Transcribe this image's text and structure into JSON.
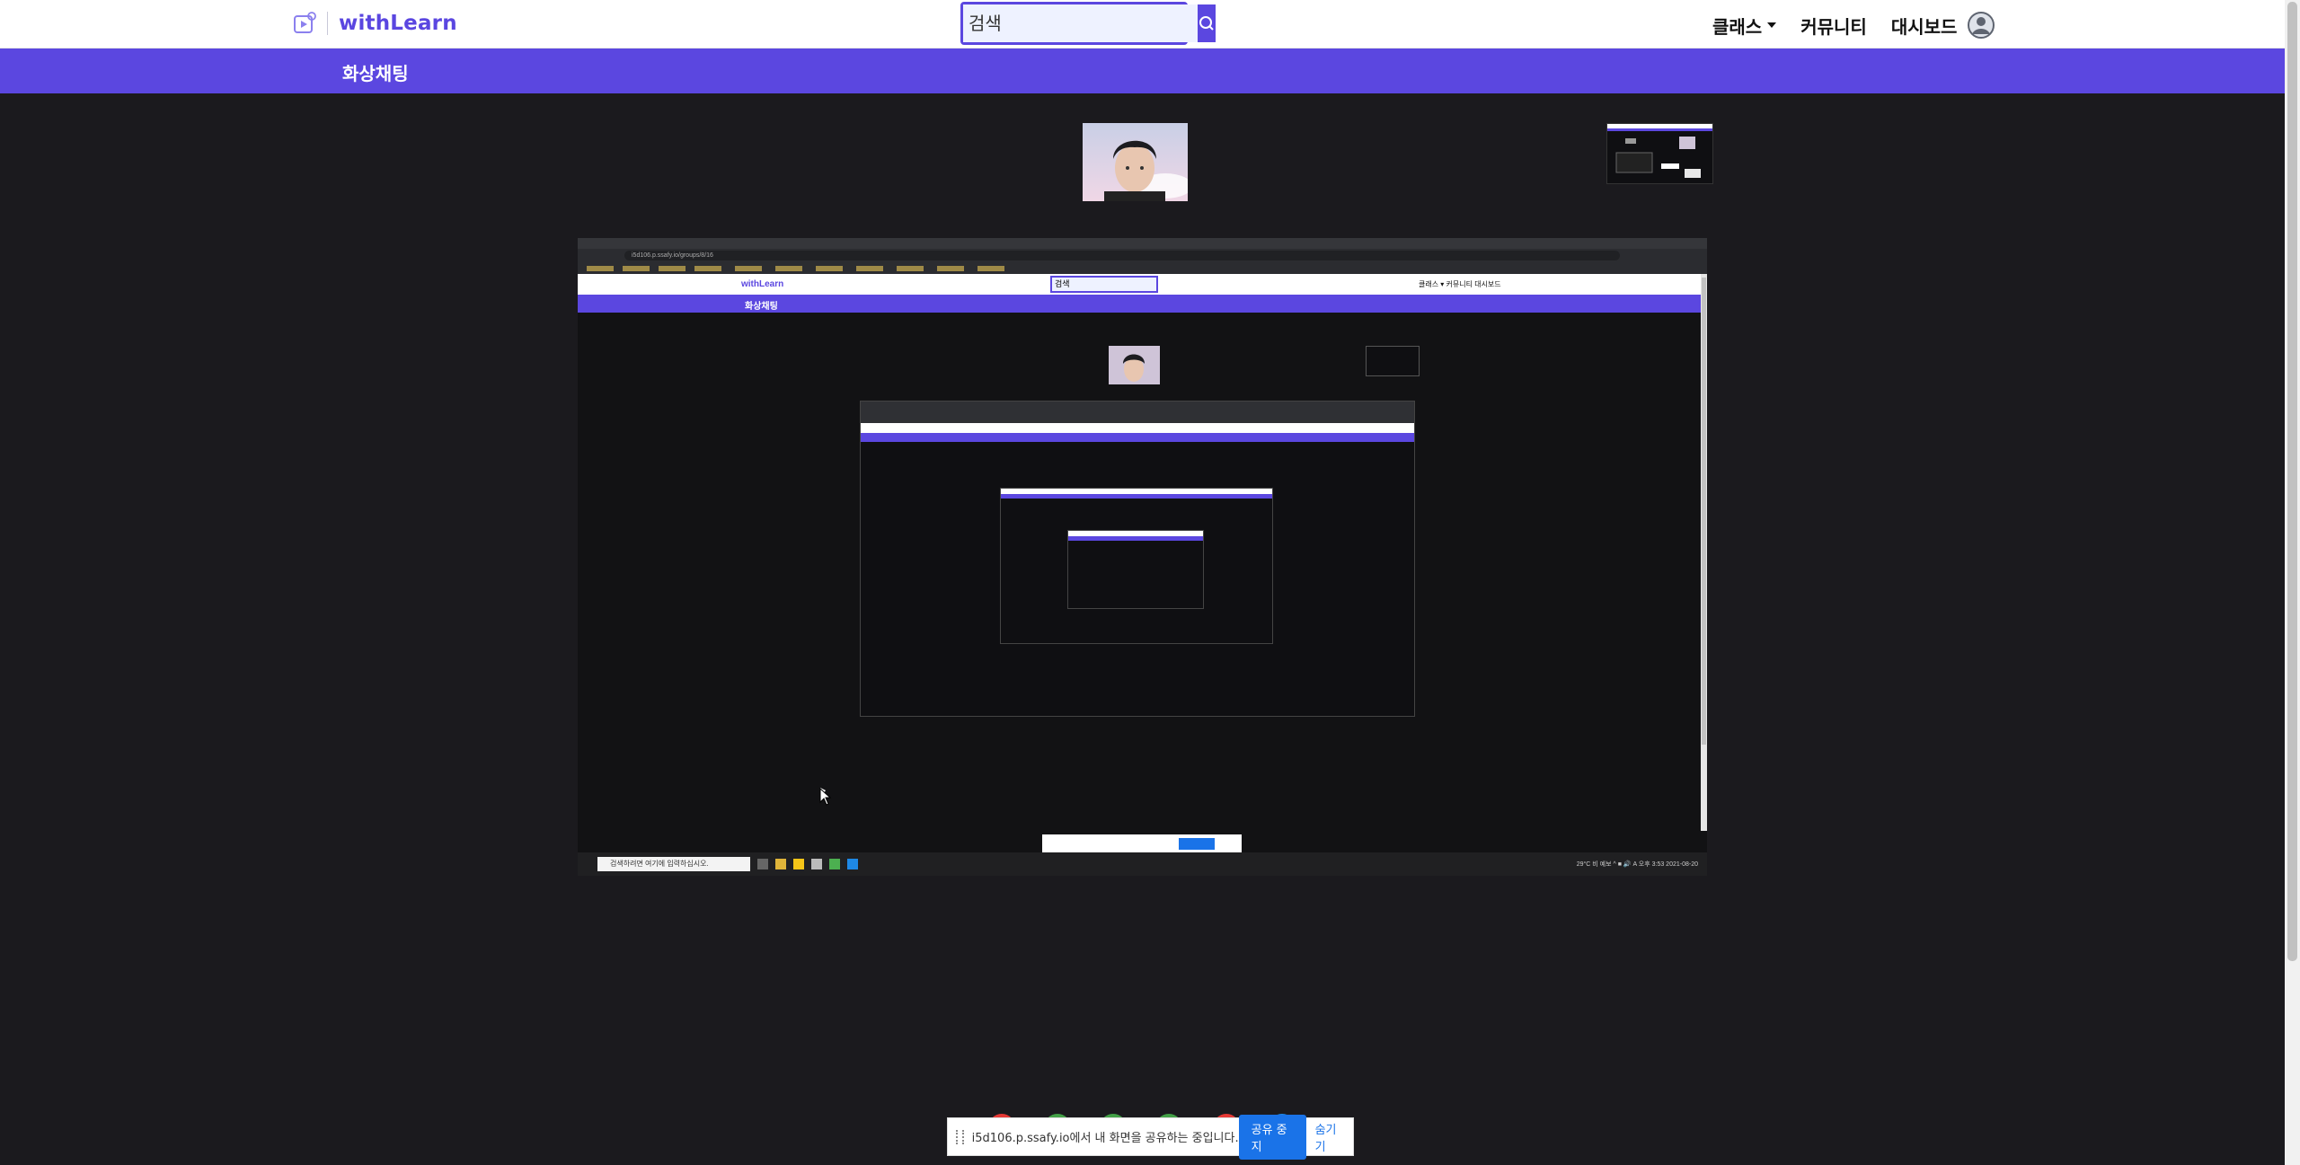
{
  "app": {
    "name": "withLearn"
  },
  "search": {
    "placeholder": "검색"
  },
  "nav": {
    "classes": "클래스",
    "community": "커뮤니티",
    "dashboard": "대시보드"
  },
  "banner": {
    "title": "화상채팅"
  },
  "shared_screen": {
    "address": "i5d106.p.ssafy.io/groups/8/16",
    "inner_logo": "withLearn",
    "inner_search": "검색",
    "inner_nav": "클래스 ▾   커뮤니티   대시보드",
    "inner_banner": "화상채팅",
    "taskbar_search": "검색하려면 여기에 입력하십시오.",
    "taskbar_right": "29°C  비 예보   ^  ■ 🔊 A  오후 3:53  2021-08-20"
  },
  "share_notice": {
    "message": "i5d106.p.ssafy.io에서 내 화면을 공유하는 중입니다.",
    "stop": "공유 중지",
    "hide": "숨기기"
  },
  "colors": {
    "brand": "#5b47e0",
    "background": "#1b1a1e",
    "share_button": "#1a73e8"
  },
  "icons": [
    "logo-video-icon",
    "search-icon",
    "chevron-down-icon",
    "user-avatar-icon",
    "mouse-cursor-icon"
  ]
}
